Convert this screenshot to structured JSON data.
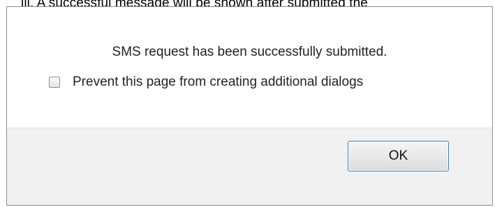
{
  "background": {
    "partial_text": "iii. A successful message will be shown after submitted the"
  },
  "dialog": {
    "message": "SMS request has been successfully submitted.",
    "prevent_checkbox": {
      "checked": false,
      "label": "Prevent this page from creating additional dialogs"
    },
    "ok_label": "OK"
  },
  "colors": {
    "dialog_border": "#8c8c8c",
    "footer_background": "#f1f1f1",
    "button_focus_border": "#3c7fb1"
  }
}
